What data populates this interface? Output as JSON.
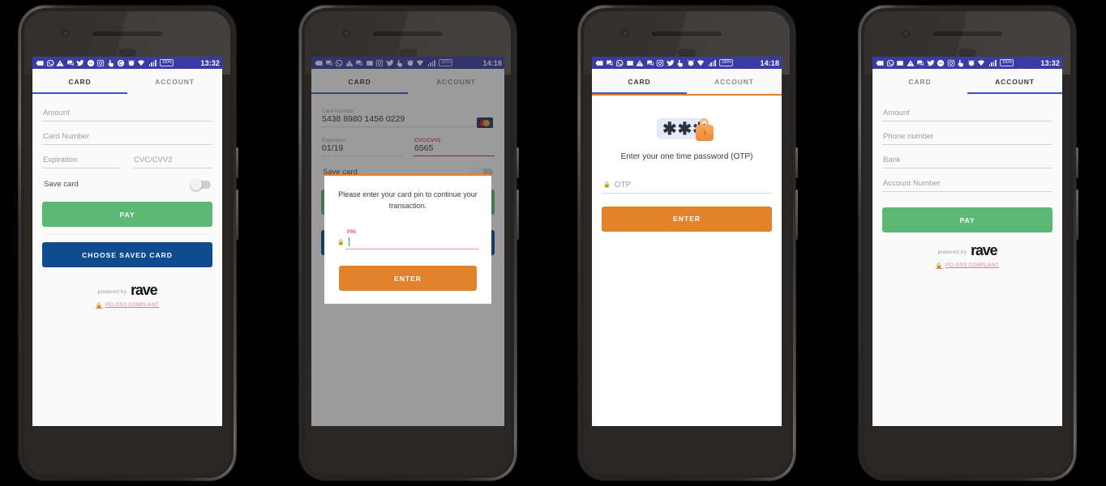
{
  "common": {
    "tab_card": "CARD",
    "tab_account": "ACCOUNT",
    "powered_by": "powered by",
    "brand": "rave",
    "pci": "PCI-DSS COMPLIANT",
    "lock_glyph": "ὑ2",
    "battery": "100%",
    "colors": {
      "statusbar": "#3b3ba5",
      "tab_indicator": "#4650c7",
      "pay_green": "#5cb874",
      "saved_card_navy": "#114b8f",
      "enter_orange": "#e2822b",
      "pci_pink": "#f2719b",
      "error_red": "#b03a4c",
      "pin_pink": "#ec4f8c",
      "screen_bg": "#fafafa",
      "page_bg": "#000000"
    }
  },
  "phone1": {
    "name": "card-entry-screen",
    "clock": "13:32",
    "active_tab": "CARD",
    "fields": [
      {
        "name": "amount",
        "placeholder": "Amount",
        "value": ""
      },
      {
        "name": "card-number",
        "placeholder": "Card Number",
        "value": ""
      },
      {
        "name": "expiration",
        "placeholder": "Expiration",
        "value": ""
      },
      {
        "name": "cvc",
        "placeholder": "CVC/CVV2",
        "value": ""
      }
    ],
    "save_card_label": "Save card",
    "save_card_on": false,
    "pay_label": "PAY",
    "saved_card_label": "CHOOSE SAVED CARD"
  },
  "phone2": {
    "name": "card-pin-dialog-screen",
    "clock": "14:18",
    "active_tab": "CARD",
    "card_number_label": "Card Number",
    "card_number_value": "5438 8980 1456 0229",
    "card_brand": "mastercard-icon",
    "expiration_label": "Expiration",
    "expiration_value": "01/19",
    "cvc_label": "CVC/CVV2",
    "cvc_value": "6565",
    "dialog_message": "Please enter your card pin to continue your transaction.",
    "pin_label": "PIN",
    "pin_value": "",
    "enter_label": "ENTER"
  },
  "phone3": {
    "name": "otp-screen",
    "clock": "14:18",
    "active_tab": "CARD",
    "stars": "✱✱✱",
    "prompt": "Enter your one time password (OTP)",
    "otp_placeholder": "OTP",
    "otp_value": "",
    "enter_label": "ENTER"
  },
  "phone4": {
    "name": "account-entry-screen",
    "clock": "13:32",
    "active_tab": "ACCOUNT",
    "fields": [
      {
        "name": "amount",
        "placeholder": "Amount",
        "value": ""
      },
      {
        "name": "phone-number",
        "placeholder": "Phone number",
        "value": ""
      },
      {
        "name": "bank",
        "placeholder": "Bank",
        "value": ""
      },
      {
        "name": "account-number",
        "placeholder": "Account Number",
        "value": ""
      }
    ],
    "pay_label": "PAY"
  }
}
